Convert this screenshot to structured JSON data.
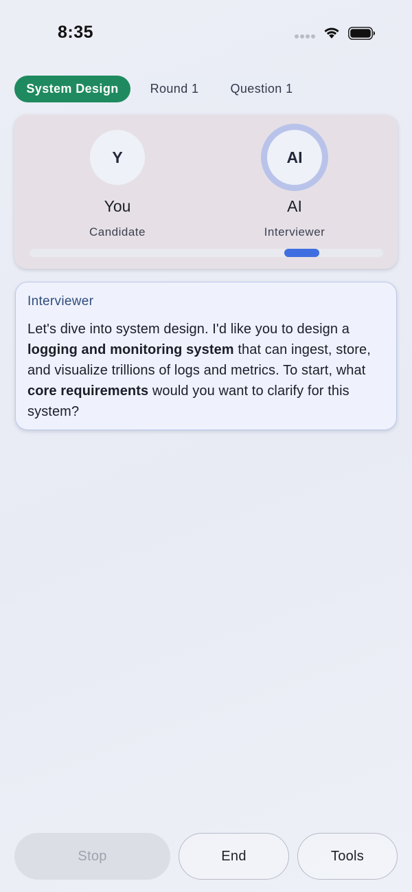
{
  "status_bar": {
    "time": "8:35",
    "icons": [
      "signal-dots-icon",
      "wifi-icon",
      "battery-icon"
    ]
  },
  "chips": [
    {
      "label": "System Design",
      "active": true
    },
    {
      "label": "Round 1",
      "active": false
    },
    {
      "label": "Question 1",
      "active": false
    }
  ],
  "participants": {
    "you": {
      "initial": "Y",
      "name": "You",
      "role": "Candidate"
    },
    "ai": {
      "initial": "AI",
      "name": "AI",
      "role": "Interviewer",
      "speaking": true
    }
  },
  "speaking_indicator": {
    "start": 0.72,
    "end": 0.82
  },
  "message": {
    "speaker": "Interviewer",
    "parts": [
      {
        "text": "Let's dive into system design. I'd like you to design a ",
        "bold": false
      },
      {
        "text": "logging and monitoring system",
        "bold": true
      },
      {
        "text": " that can ingest, store, and visualize trillions of logs and metrics. To start, what ",
        "bold": false
      },
      {
        "text": "core requirements",
        "bold": true
      },
      {
        "text": " would you want to clarify for this system?",
        "bold": false
      }
    ]
  },
  "actions": {
    "stop": "Stop",
    "end": "End",
    "tools": "Tools"
  },
  "colors": {
    "accent": "#1f8a5f",
    "progress": "#3f6ee0",
    "speaking_ring": "#b9c3ea"
  }
}
